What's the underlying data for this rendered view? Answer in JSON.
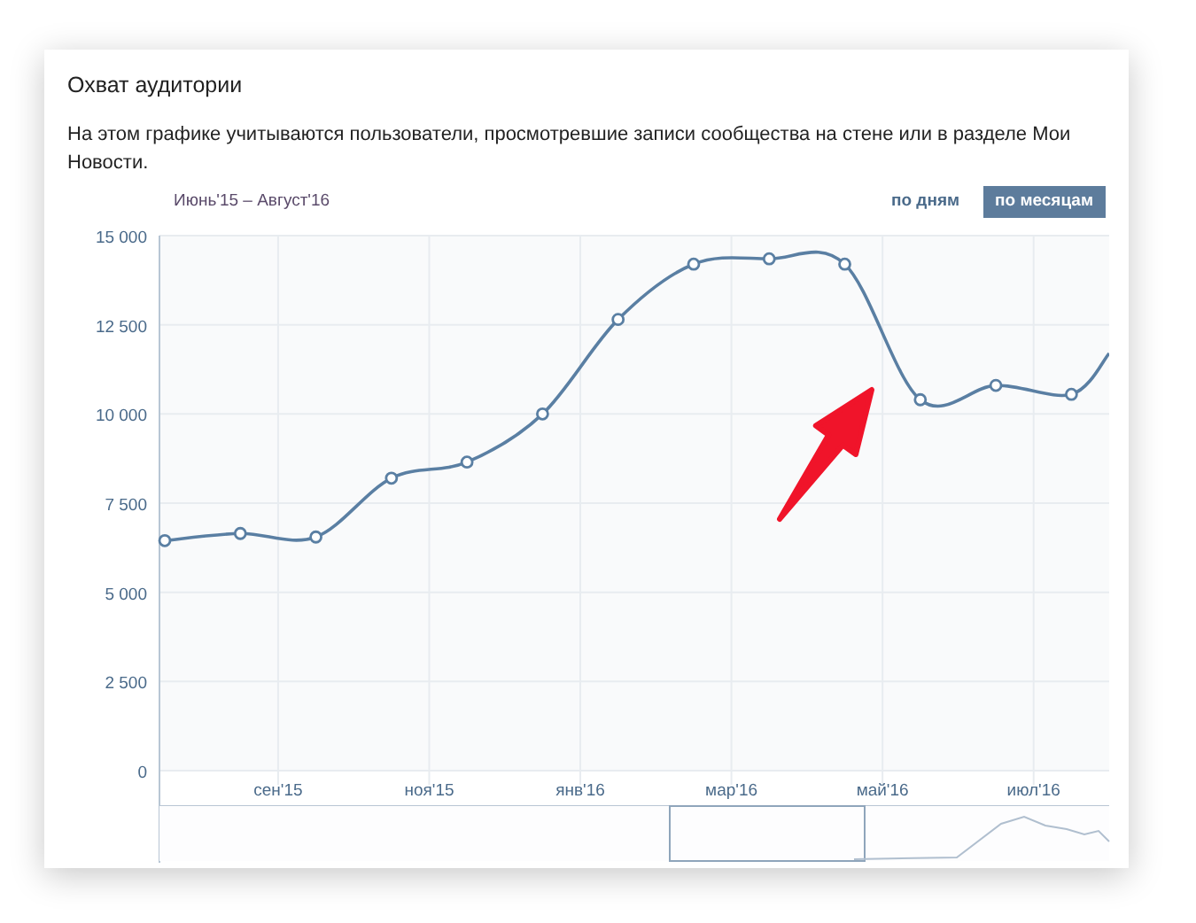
{
  "card": {
    "title": "Охват аудитории",
    "description": "На этом графике учитываются пользователи, просмотревшие записи сообщества на стене или в разделе Мои Новости."
  },
  "period": "Июнь'15 – Август'16",
  "tabs": [
    {
      "label": "по дням",
      "selected": false
    },
    {
      "label": "по месяцам",
      "selected": true
    }
  ],
  "chart_data": {
    "type": "line",
    "categories": [
      null,
      null,
      null,
      "сен'15",
      null,
      null,
      null,
      "ноя'15",
      null,
      null,
      null,
      "янв'16",
      null,
      null,
      null,
      "мар'16",
      null,
      null,
      null,
      "май'16",
      null,
      null,
      null,
      "июл'16",
      null,
      null
    ],
    "series": [
      {
        "color": "#5a7fa3",
        "marker": "circle",
        "values": [
          6450,
          null,
          6650,
          null,
          6550,
          null,
          8200,
          null,
          8650,
          null,
          10000,
          null,
          12650,
          null,
          14200,
          null,
          14350,
          null,
          14200,
          null,
          10400,
          null,
          10800,
          null,
          10550,
          11700
        ]
      }
    ],
    "ylim": [
      0,
      15000
    ],
    "grid": true,
    "yticks": [
      {
        "value": 0,
        "label": "0"
      },
      {
        "value": 2500,
        "label": "2 500"
      },
      {
        "value": 5000,
        "label": "5 000"
      },
      {
        "value": 7500,
        "label": "7 500"
      },
      {
        "value": 10000,
        "label": "10 000"
      },
      {
        "value": 12500,
        "label": "12 500"
      },
      {
        "value": 15000,
        "label": "15 000"
      }
    ]
  }
}
